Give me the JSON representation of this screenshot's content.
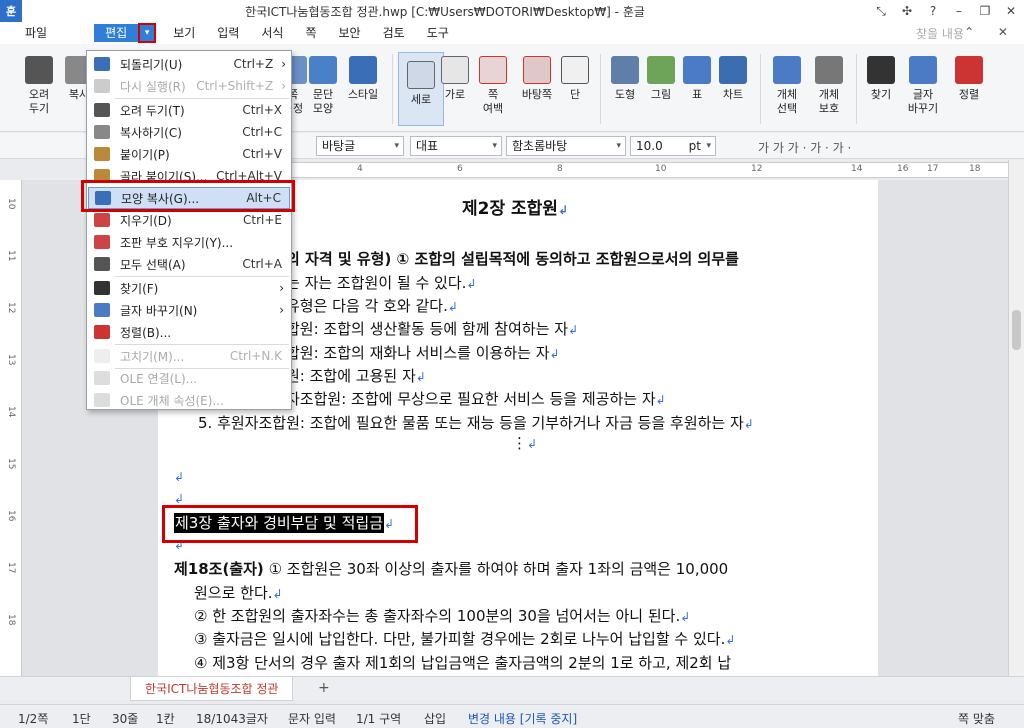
{
  "window": {
    "title": "한국ICT나눔협동조합 정관.hwp [C:₩Users₩DOTORI₩Desktop₩] - 훈글",
    "logo": "훈",
    "controls": [
      "⤡",
      "✣",
      "?",
      "–",
      "❐",
      "✕"
    ]
  },
  "menu": {
    "items": [
      "파일",
      "편집",
      "보기",
      "입력",
      "서식",
      "쪽",
      "보안",
      "검토",
      "도구"
    ],
    "search_placeholder": "찾을 내용",
    "right_controls": "⌃ ✕"
  },
  "ribbon": {
    "buttons": [
      "오려\n두기",
      "복사",
      "쪽\n설정",
      "문단\n모양",
      "스타일",
      "세로",
      "가로",
      "쪽\n여백",
      "바탕쪽",
      "단",
      "도형",
      "그림",
      "표",
      "차트",
      "개체\n선택",
      "개체\n보호",
      "찾기",
      "글자\n바꾸기",
      "정렬"
    ]
  },
  "format_bar": {
    "style": "바탕글",
    "font_lang": "대표",
    "font": "함초롬바탕",
    "size": "10.0",
    "size_unit": "pt",
    "text_style_btns": "가 가 가 · 가 · 가 ·"
  },
  "ruler": {
    "ticks": [
      "1",
      "2",
      "4",
      "6",
      "8",
      "10",
      "12",
      "14",
      "16",
      "17",
      "18"
    ],
    "vticks": [
      "10",
      "11",
      "12",
      "13",
      "14",
      "15",
      "16",
      "17",
      "18",
      "19"
    ]
  },
  "edit_menu": {
    "items": [
      {
        "label": "되돌리기(U)",
        "shortcut": "Ctrl+Z",
        "arrow": "›",
        "disabled": false
      },
      {
        "label": "다시 실행(R)",
        "shortcut": "Ctrl+Shift+Z",
        "arrow": "›",
        "disabled": true
      },
      {
        "label": "오려 두기(T)",
        "shortcut": "Ctrl+X",
        "disabled": false
      },
      {
        "label": "복사하기(C)",
        "shortcut": "Ctrl+C",
        "disabled": false
      },
      {
        "label": "붙이기(P)",
        "shortcut": "Ctrl+V",
        "disabled": false
      },
      {
        "label": "골라 붙이기(S)...",
        "shortcut": "Ctrl+Alt+V",
        "disabled": false
      },
      {
        "label": "모양 복사(G)...",
        "shortcut": "Alt+C",
        "disabled": false,
        "highlighted": true
      },
      {
        "label": "지우기(D)",
        "shortcut": "Ctrl+E",
        "disabled": false
      },
      {
        "label": "조판 부호 지우기(Y)...",
        "shortcut": "",
        "disabled": false
      },
      {
        "label": "모두 선택(A)",
        "shortcut": "Ctrl+A",
        "disabled": false
      },
      {
        "label": "찾기(F)",
        "shortcut": "",
        "arrow": "›",
        "disabled": false
      },
      {
        "label": "글자 바꾸기(N)",
        "shortcut": "",
        "arrow": "›",
        "disabled": false
      },
      {
        "label": "정렬(B)...",
        "shortcut": "",
        "disabled": false
      },
      {
        "label": "고치기(M)...",
        "shortcut": "Ctrl+N.K",
        "disabled": true
      },
      {
        "label": "OLE 연결(L)...",
        "shortcut": "",
        "disabled": true
      },
      {
        "label": "OLE 개체 속성(E)...",
        "shortcut": "",
        "disabled": true
      }
    ]
  },
  "document": {
    "chapter2": "제2장 조합원",
    "l1": "의 자격 및 유형) ① 조합의 설립목적에 동의하고 조합원으로서의 의무를",
    "l2": "는 자는 조합원이 될 수 있다.",
    "l3": "유형은 다음 각 호와 같다.",
    "l4": "합원: 조합의 생산활동 등에 함께 참여하는 자",
    "l5": "합원: 조합의 재화나 서비스를 이용하는 자",
    "l6": "원: 조합에 고용된 자",
    "l7": "자조합원: 조합에 무상으로 필요한 서비스 등을 제공하는 자",
    "l8": "5. 후원자조합원: 조합에 필요한 물품 또는 재능 등을 기부하거나 자금 등을 후원하는 자",
    "l9": "⋮",
    "chapter3": "제3장 출자와 경비부담 및 적립금",
    "a18_head": "제18조(출자)",
    "a18_l1": "① 조합원은 30좌 이상의 출자를 하여야 하며 출자 1좌의 금액은 10,000",
    "a18_l2": "원으로 한다.",
    "a18_l3": "② 한 조합원의 출자좌수는 총 출자좌수의 100분의 30을 넘어서는 아니 된다.",
    "a18_l4": "③ 출자금은 일시에 납입한다. 다만, 불가피할 경우에는 2회로 나누어 납입할 수 있다.",
    "a18_l5": "④ 제3항 단서의 경우 출자 제1회의 납입금액은 출자금액의 2분의 1로 하고, 제2회 납",
    "return_mark": "↲"
  },
  "tabs": {
    "doc_tab": "한국ICT나눔협동조합 정관",
    "add": "+"
  },
  "status": {
    "page": "1/2쪽",
    "column": "1단",
    "line": "30줄",
    "col": "1칸",
    "chars": "18/1043글자",
    "input_mode": "문자 입력",
    "section": "1/1 구역",
    "insert": "삽입",
    "track": "변경 내용 [기록 중지]",
    "zoom": "쪽 맞춤"
  }
}
